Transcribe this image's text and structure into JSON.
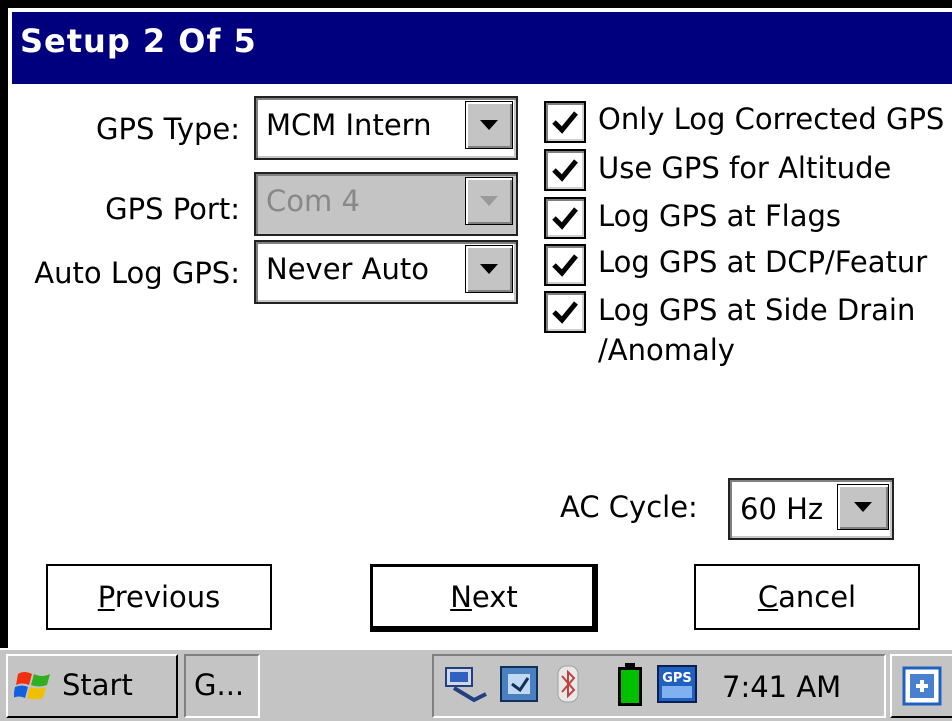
{
  "window": {
    "title": "Setup 2 Of 5"
  },
  "form": {
    "gps_type": {
      "label": "GPS Type:",
      "value": "MCM Intern"
    },
    "gps_port": {
      "label": "GPS Port:",
      "value": "Com 4"
    },
    "auto_log": {
      "label": "Auto Log GPS:",
      "value": "Never Auto"
    },
    "ac_cycle": {
      "label": "AC  Cycle:",
      "value": "60 Hz"
    }
  },
  "checkboxes": [
    {
      "label": "Only Log Corrected GPS",
      "checked": true
    },
    {
      "label": "Use GPS for Altitude",
      "checked": true
    },
    {
      "label": "Log GPS at Flags",
      "checked": true
    },
    {
      "label": "Log GPS at DCP/Featur",
      "checked": true
    },
    {
      "label": "Log GPS at Side Drain",
      "label2": "/Anomaly",
      "checked": true
    }
  ],
  "buttons": {
    "previous": {
      "accel": "P",
      "rest": "revious"
    },
    "next": {
      "accel": "N",
      "rest": "ext"
    },
    "cancel": {
      "accel": "C",
      "rest": "ancel"
    }
  },
  "taskbar": {
    "start_label": "Start",
    "task_label": "G...",
    "clock": "7:41 AM"
  },
  "colors": {
    "titlebar": "#00007f",
    "face": "#c4c4c4",
    "battery": "#00c000"
  }
}
